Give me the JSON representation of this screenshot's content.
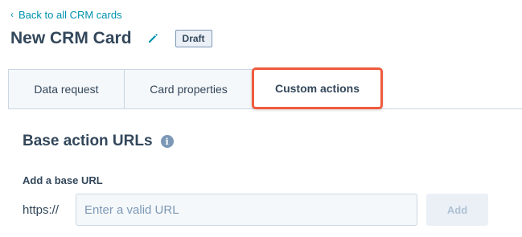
{
  "back_link": {
    "icon": "chevron-left-icon",
    "label": "Back to all CRM cards"
  },
  "header": {
    "title": "New CRM Card",
    "edit_icon": "pencil-icon",
    "status_badge": "Draft"
  },
  "tabs": [
    {
      "label": "Data request",
      "active": false
    },
    {
      "label": "Card properties",
      "active": false
    },
    {
      "label": "Custom actions",
      "active": true,
      "highlighted": true
    }
  ],
  "section": {
    "title": "Base action URLs",
    "info_icon": "info-icon",
    "field_label": "Add a base URL",
    "prefix": "https://",
    "input_value": "",
    "input_placeholder": "Enter a valid URL",
    "add_button_label": "Add",
    "add_button_disabled": true
  },
  "colors": {
    "link": "#0091ae",
    "text": "#33475b",
    "highlight": "#f15a3c",
    "border": "#cbd6e2",
    "disabled_text": "#b0c1d4"
  }
}
